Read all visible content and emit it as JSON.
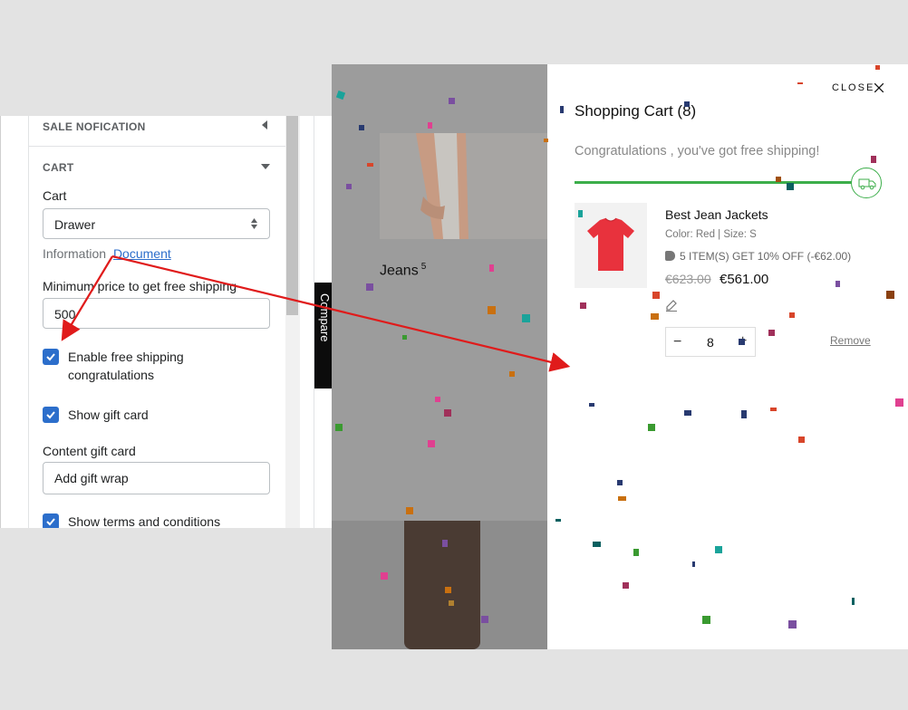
{
  "settings": {
    "sale_notification_header": "SALE NOFICATION",
    "cart_header": "CART",
    "cart_label": "Cart",
    "cart_select_value": "Drawer",
    "info_label": "Information",
    "info_link": "Document",
    "min_price_label": "Minimum price to get free shipping",
    "min_price_value": "500",
    "enable_free_shipping_label": "Enable free shipping congratulations",
    "show_gift_card_label": "Show gift card",
    "content_gift_card_label": "Content gift card",
    "content_gift_card_value": "Add gift wrap",
    "show_terms_label": "Show terms and conditions"
  },
  "store": {
    "product_label": "Jeans",
    "product_count": "5",
    "compare_label": "Compare"
  },
  "cart": {
    "close_label": "CLOSE",
    "title": "Shopping Cart (8)",
    "congrats": "Congratulations , you've got free shipping!",
    "free_shipping_progress": 1.0,
    "item": {
      "name": "Best Jean Jackets",
      "variant": "Color: Red  | Size: S",
      "discount": "5 ITEM(S) GET 10% OFF (-€62.00)",
      "old_price": "€623.00",
      "new_price": "€561.00",
      "quantity": "8",
      "remove_label": "Remove"
    }
  },
  "colors": {
    "checkbox": "#2c6ecb",
    "progress": "#3cae4a",
    "annotation_arrow": "#e01b1b",
    "link": "#2c6ecb"
  },
  "icons": [
    "caret-left-icon",
    "caret-down-icon",
    "select-arrows-icon",
    "check-icon",
    "close-icon",
    "truck-icon",
    "tag-icon",
    "edit-icon",
    "minus-icon",
    "plus-icon"
  ]
}
